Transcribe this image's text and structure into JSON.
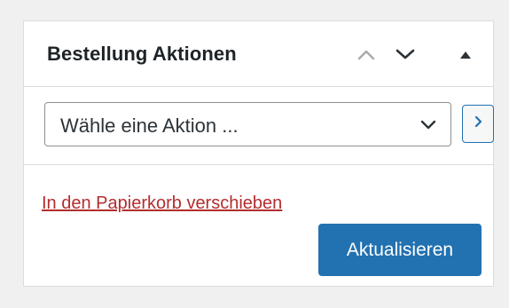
{
  "panel": {
    "title": "Bestellung Aktionen",
    "move_up_icon": "chevron-up-icon",
    "move_down_icon": "chevron-down-icon",
    "toggle_icon": "triangle-up-icon"
  },
  "actions": {
    "select_value": "Wähle eine Aktion ...",
    "select_icon": "chevron-down-icon",
    "go_icon": "chevron-right-icon"
  },
  "footer": {
    "trash_link": "In den Papierkorb verschieben",
    "update_button": "Aktualisieren"
  },
  "colors": {
    "primary": "#2271b1",
    "danger": "#b32d2e",
    "border": "#dcdcde",
    "background": "#f0f0f1"
  }
}
